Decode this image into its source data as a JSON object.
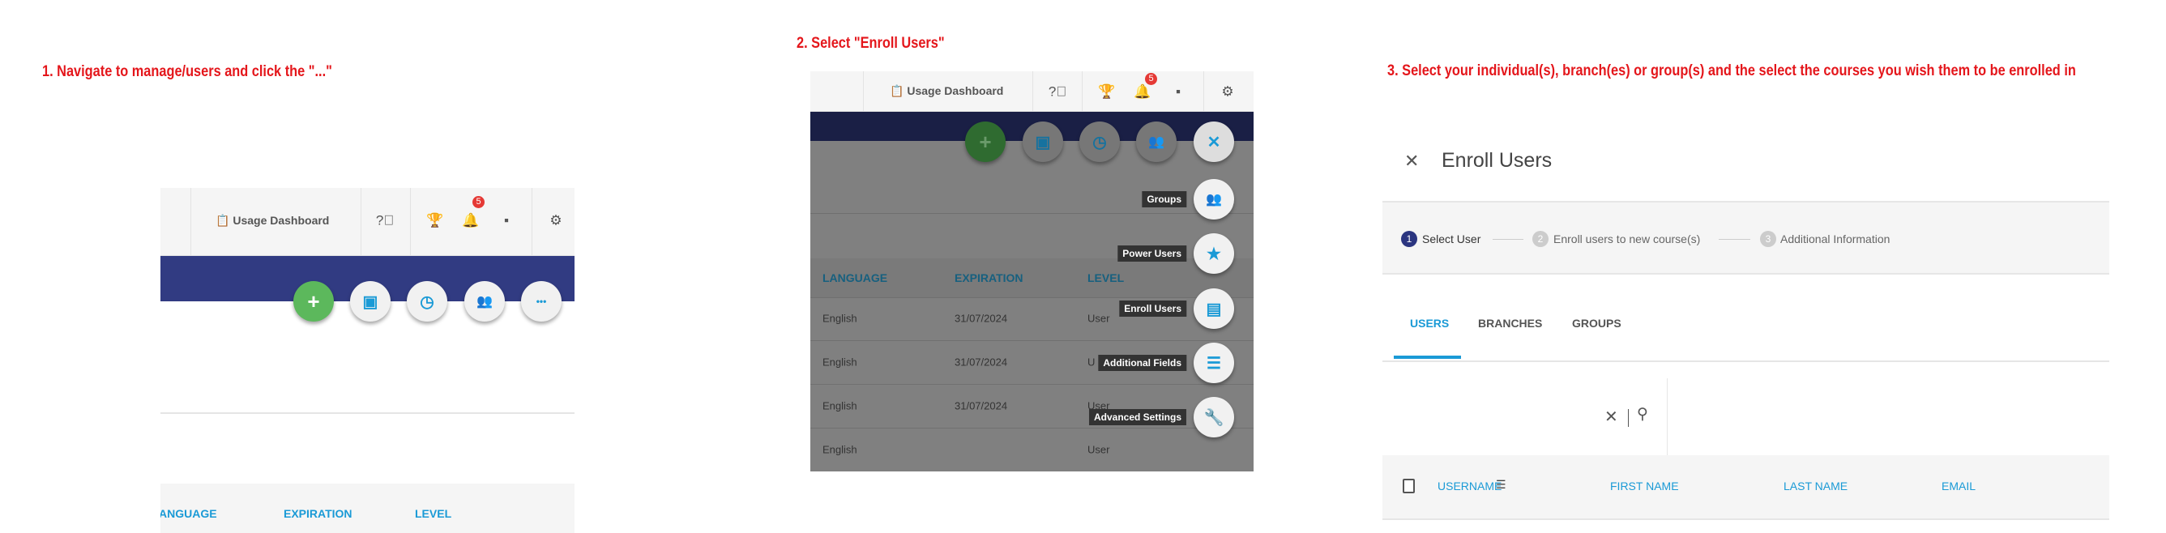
{
  "colors": {
    "instruction": "#e4161b",
    "navy": "#313b82",
    "accent": "#1a9ad6",
    "green": "#5cb85c",
    "badge": "#e53935"
  },
  "panel1": {
    "instruction": "1. Navigate to manage/users and click the \"...\"",
    "header": {
      "usage_dashboard": "Usage Dashboard",
      "notifications_count": "5"
    },
    "fabs": [
      {
        "icon": "plus-icon",
        "glyph": "+"
      },
      {
        "icon": "archive-download-icon",
        "glyph": "▣"
      },
      {
        "icon": "clock-icon",
        "glyph": "◷"
      },
      {
        "icon": "users-icon",
        "glyph": "👥"
      },
      {
        "icon": "more-icon",
        "glyph": "•••"
      }
    ],
    "columns": [
      "ANGUAGE",
      "EXPIRATION",
      "LEVEL"
    ]
  },
  "panel2": {
    "instruction": "2. Select \"Enroll  Users\"",
    "header": {
      "usage_dashboard": "Usage Dashboard",
      "notifications_count": "5"
    },
    "columns": [
      "LANGUAGE",
      "EXPIRATION",
      "LEVEL"
    ],
    "rows": [
      [
        "English",
        "31/07/2024",
        "User"
      ],
      [
        "English",
        "31/07/2024",
        "U"
      ],
      [
        "English",
        "31/07/2024",
        "User"
      ],
      [
        "English",
        "",
        "User"
      ]
    ],
    "menu": [
      {
        "label": "Groups",
        "icon": "groups-icon",
        "glyph": "👥"
      },
      {
        "label": "Power Users",
        "icon": "power-users-icon",
        "glyph": "★"
      },
      {
        "label": "Enroll Users",
        "icon": "enroll-users-icon",
        "glyph": "▤"
      },
      {
        "label": "Additional Fields",
        "icon": "list-icon",
        "glyph": "☰"
      },
      {
        "label": "Advanced Settings",
        "icon": "wrench-icon",
        "glyph": "🔧"
      }
    ],
    "close_glyph": "✕"
  },
  "panel3": {
    "instruction": "3. Select your individual(s), branch(es) or group(s) and the select the courses you wish them to be enrolled in",
    "title": "Enroll Users",
    "steps": [
      {
        "num": "1",
        "label": "Select User",
        "active": true
      },
      {
        "num": "2",
        "label": "Enroll users to new course(s)",
        "active": false
      },
      {
        "num": "3",
        "label": "Additional Information",
        "active": false
      }
    ],
    "tabs": [
      "USERS",
      "BRANCHES",
      "GROUPS"
    ],
    "active_tab": "USERS",
    "columns": [
      "USERNAME",
      "FIRST NAME",
      "LAST NAME",
      "EMAIL"
    ]
  }
}
